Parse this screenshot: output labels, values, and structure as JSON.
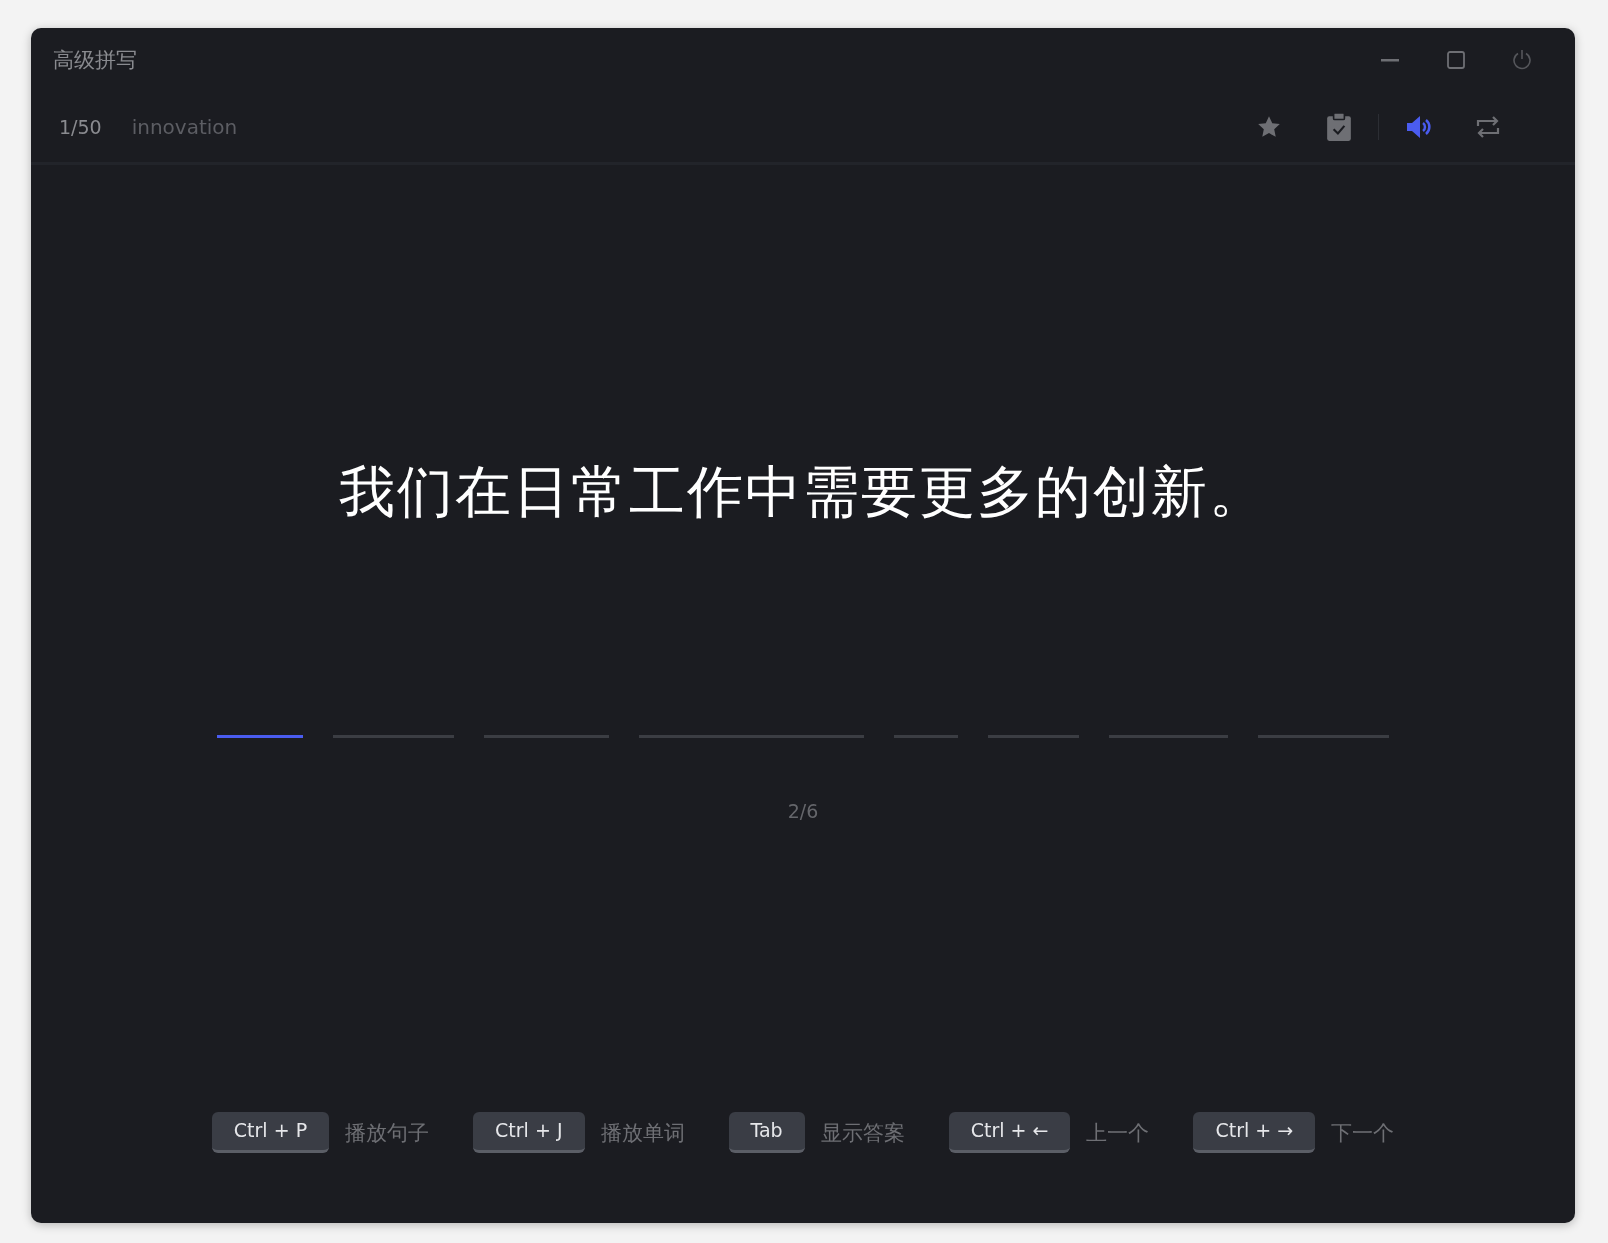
{
  "window": {
    "title": "高级拼写"
  },
  "toolbar": {
    "progress": "1/50",
    "word": "innovation",
    "actions": [
      {
        "kind": "star",
        "on": false
      },
      {
        "kind": "clipboard",
        "on": false
      },
      {
        "kind": "speaker",
        "on": true
      },
      {
        "kind": "repeat",
        "on": false
      }
    ]
  },
  "sentence": "我们在日常工作中需要更多的创新。",
  "blanks": [
    {
      "selected": true
    },
    {
      "selected": false
    },
    {
      "selected": false
    },
    {
      "selected": false
    },
    {
      "selected": false
    },
    {
      "selected": false
    },
    {
      "selected": false
    },
    {
      "selected": false
    }
  ],
  "counter": "2/6",
  "shortcuts": [
    {
      "key": "Ctrl + P",
      "label": "播放句子"
    },
    {
      "key": "Ctrl + J",
      "label": "播放单词"
    },
    {
      "key": "Tab",
      "label": "显示答案"
    },
    {
      "key": "Ctrl + ←",
      "label": "上一个"
    },
    {
      "key": "Ctrl + →",
      "label": "下一个"
    }
  ]
}
